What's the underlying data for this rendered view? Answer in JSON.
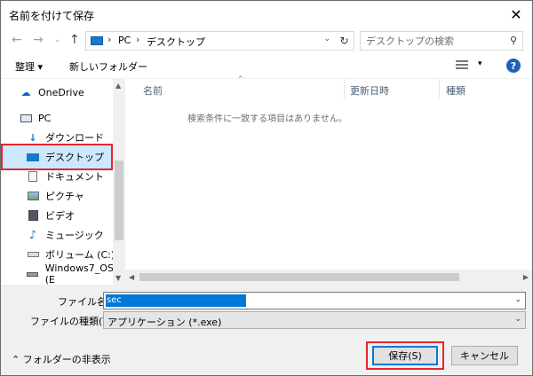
{
  "window": {
    "title": "名前を付けて保存"
  },
  "address": {
    "crumbs": [
      "PC",
      "デスクトップ"
    ],
    "search_placeholder": "デスクトップの検索"
  },
  "toolbar": {
    "organize_label": "整理 ▾",
    "new_folder_label": "新しいフォルダー"
  },
  "nav": {
    "items": [
      {
        "label": "OneDrive",
        "icon": "onedrive-icon"
      },
      {
        "label": "PC",
        "icon": "pc-icon"
      },
      {
        "label": "ダウンロード",
        "icon": "download-icon"
      },
      {
        "label": "デスクトップ",
        "icon": "desktop-icon",
        "selected": true
      },
      {
        "label": "ドキュメント",
        "icon": "document-icon"
      },
      {
        "label": "ピクチャ",
        "icon": "picture-icon"
      },
      {
        "label": "ビデオ",
        "icon": "video-icon"
      },
      {
        "label": "ミュージック",
        "icon": "music-icon"
      },
      {
        "label": "ボリューム (C:)",
        "icon": "drive-icon"
      },
      {
        "label": "Windows7_OS (E",
        "icon": "drive-icon"
      }
    ]
  },
  "columns": [
    "名前",
    "更新日時",
    "種類"
  ],
  "empty_message": "検索条件に一致する項目はありません。",
  "fields": {
    "filename_label": "ファイル名(N):",
    "filename_value": "sec",
    "filetype_label": "ファイルの種類(T):",
    "filetype_value": "アプリケーション (*.exe)"
  },
  "footer": {
    "hide_folders_label": "フォルダーの非表示",
    "save_label": "保存(S)",
    "cancel_label": "キャンセル"
  },
  "colors": {
    "highlight_red": "#e8242c",
    "selection_blue": "#0078d7",
    "nav_selected": "#cce8ff"
  }
}
